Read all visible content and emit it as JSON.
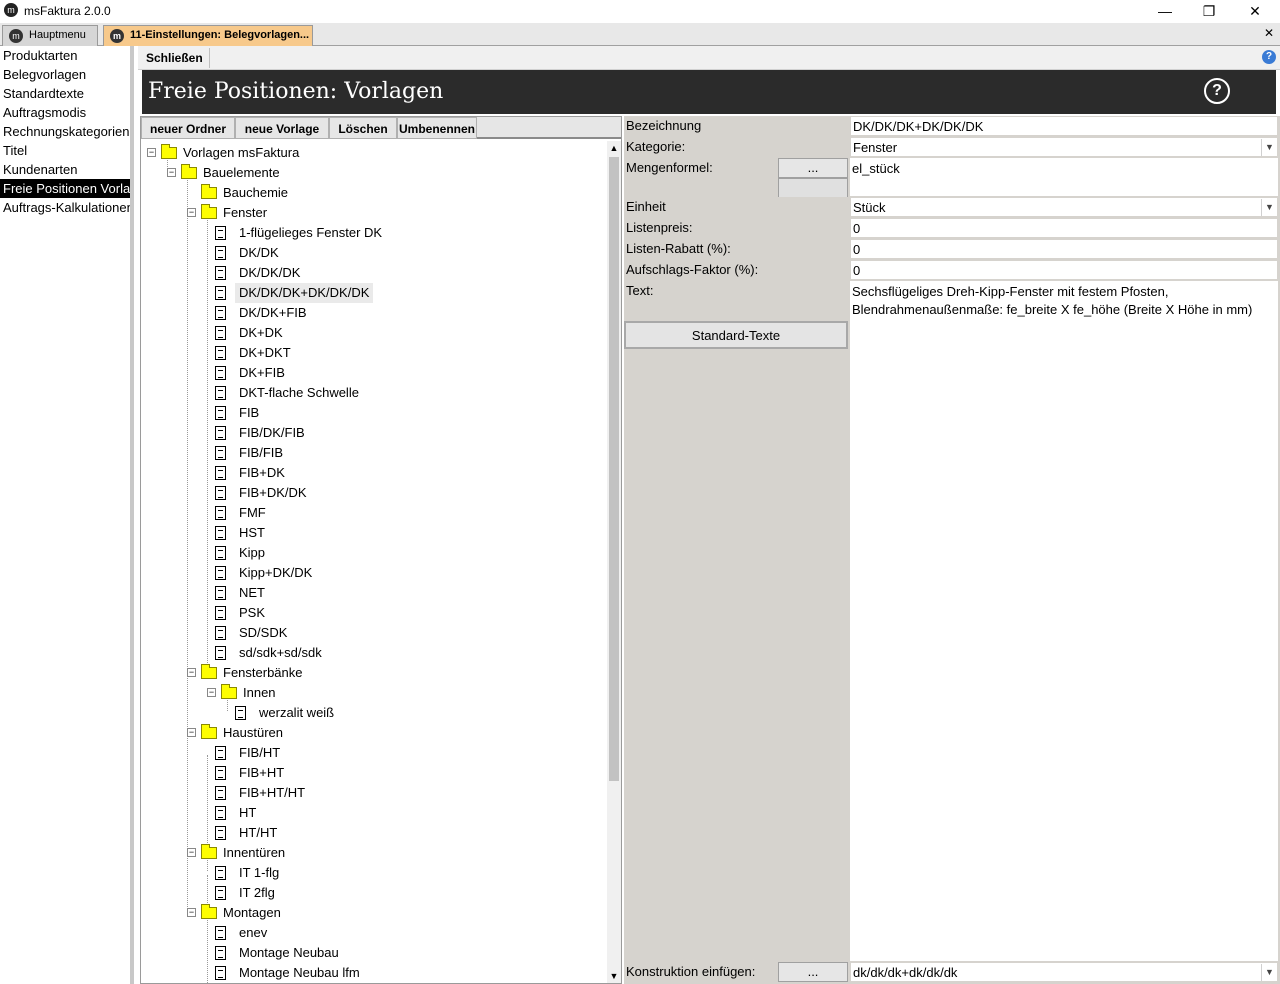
{
  "window": {
    "title": "msFaktura 2.0.0",
    "minimize": "—",
    "maximize": "❐",
    "close": "✕"
  },
  "tabs": [
    {
      "label": "Hauptmenu"
    },
    {
      "label": "11-Einstellungen: Belegvorlagen..."
    }
  ],
  "tab_close": "✕",
  "left_nav": {
    "items": [
      "Produktarten",
      "Belegvorlagen",
      "Standardtexte",
      "Auftragsmodis",
      "Rechnungskategorien",
      "Titel",
      "Kundenarten",
      "Freie Positionen Vorlagen",
      "Auftrags-Kalkulationen"
    ],
    "active_index": 7
  },
  "toolbar": {
    "close_label": "Schließen",
    "help_glyph": "?"
  },
  "header": {
    "title": "Freie Positionen: Vorlagen",
    "help_glyph": "?"
  },
  "tree_buttons": {
    "new_folder": "neuer Ordner",
    "new_template": "neue Vorlage",
    "delete": "Löschen",
    "rename": "Umbenennen"
  },
  "tree": {
    "root": "Vorlagen msFaktura",
    "bauelemente": "Bauelemente",
    "bauchemie": "Bauchemie",
    "fenster": "Fenster",
    "fenster_items": [
      "1-flügelieges Fenster DK",
      "DK/DK",
      "DK/DK/DK",
      "DK/DK/DK+DK/DK/DK",
      "DK/DK+FIB",
      "DK+DK",
      "DK+DKT",
      "DK+FIB",
      "DKT-flache Schwelle",
      "FIB",
      "FIB/DK/FIB",
      "FIB/FIB",
      "FIB+DK",
      "FIB+DK/DK",
      "FMF",
      "HST",
      "Kipp",
      "Kipp+DK/DK",
      "NET",
      "PSK",
      "SD/SDK",
      "sd/sdk+sd/sdk"
    ],
    "fensterbaenke": "Fensterbänke",
    "innen": "Innen",
    "innen_items": [
      "werzalit weiß"
    ],
    "haustueren": "Haustüren",
    "haustueren_items": [
      "FIB/HT",
      "FIB+HT",
      "FIB+HT/HT",
      "HT",
      "HT/HT"
    ],
    "innentueren": "Innentüren",
    "innentueren_items": [
      "IT 1-flg",
      "IT 2flg"
    ],
    "montagen": "Montagen",
    "montagen_items": [
      "enev",
      "Montage Neubau",
      "Montage Neubau lfm"
    ],
    "selected": "DK/DK/DK+DK/DK/DK"
  },
  "form": {
    "bezeichnung_label": "Bezeichnung",
    "bezeichnung_value": "DK/DK/DK+DK/DK/DK",
    "kategorie_label": "Kategorie:",
    "kategorie_value": "Fenster",
    "mengenformel_label": "Mengenformel:",
    "mengenformel_btn": "...",
    "mengenformel_value": "el_stück",
    "einheit_label": "Einheit",
    "einheit_value": "Stück",
    "listenpreis_label": "Listenpreis:",
    "listenpreis_value": "0",
    "rabatt_label": "Listen-Rabatt (%):",
    "rabatt_value": "0",
    "aufschlag_label": "Aufschlags-Faktor (%):",
    "aufschlag_value": "0",
    "text_label": "Text:",
    "text_value": "Sechsflügeliges Dreh-Kipp-Fenster mit festem Pfosten, Blendrahmenaußenmaße: fe_breite X fe_höhe (Breite X Höhe in mm)",
    "standard_texte_btn": "Standard-Texte",
    "konstruktion_label": "Konstruktion einfügen:",
    "konstruktion_btn": "...",
    "konstruktion_value": "dk/dk/dk+dk/dk/dk",
    "dropdown_glyph": "▼"
  },
  "scroll": {
    "up": "▲",
    "down": "▼"
  }
}
